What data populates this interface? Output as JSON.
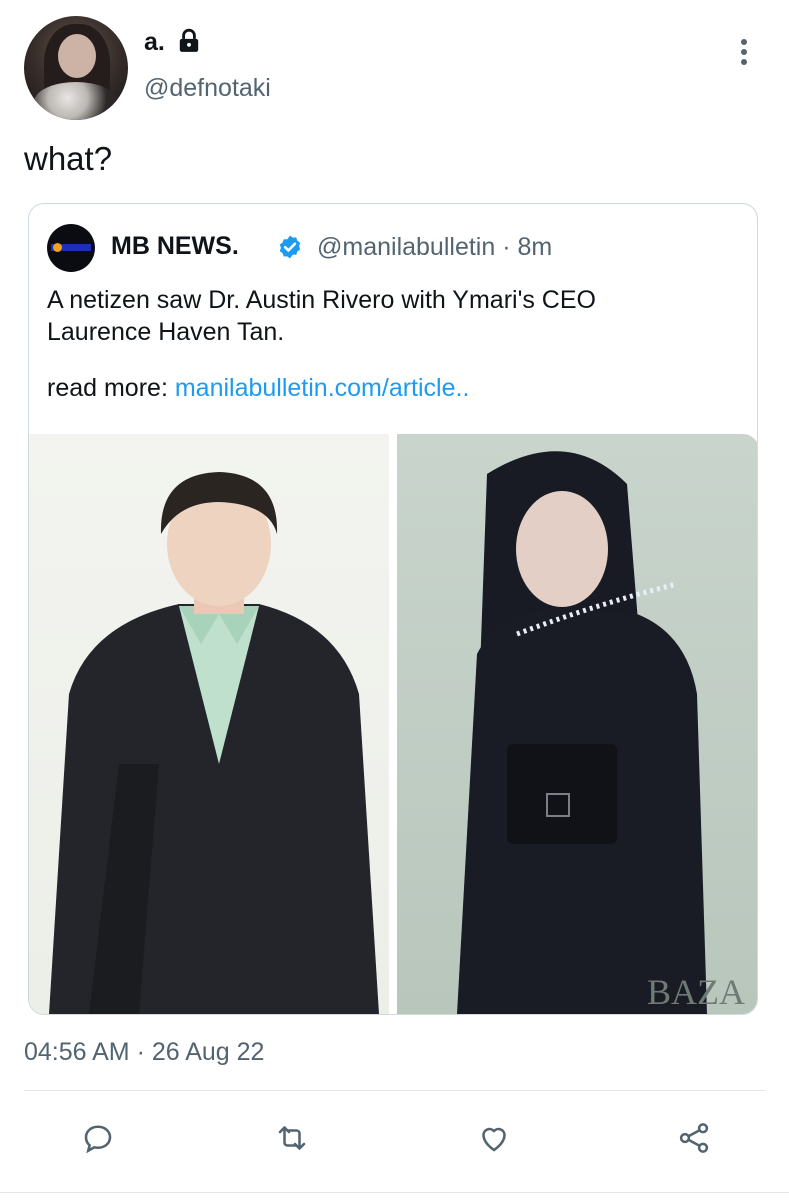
{
  "tweet": {
    "display_name": "a.",
    "handle": "@defnotaki",
    "text": "what?",
    "timestamp": "04:56 AM · 26 Aug 22",
    "icons": {
      "protected": "lock-icon",
      "more": "more-vertical-icon"
    }
  },
  "quote": {
    "name": "MB NEWS.",
    "handle_time": "@manilabulletin · 8m",
    "verified_icon": "verified-badge-icon",
    "text_line1": "A netizen saw Dr. Austin Rivero with Ymari's CEO",
    "text_line2": "Laurence Haven Tan.",
    "read_more_label": "read more: ",
    "link_text": "manilabulletin.com/article..",
    "watermark": "BAZA"
  },
  "actions": [
    "reply-icon",
    "retweet-icon",
    "like-icon",
    "share-icon"
  ],
  "colors": {
    "accent": "#1d9bf0",
    "secondary_text": "#536471",
    "border": "#cfd9de"
  }
}
